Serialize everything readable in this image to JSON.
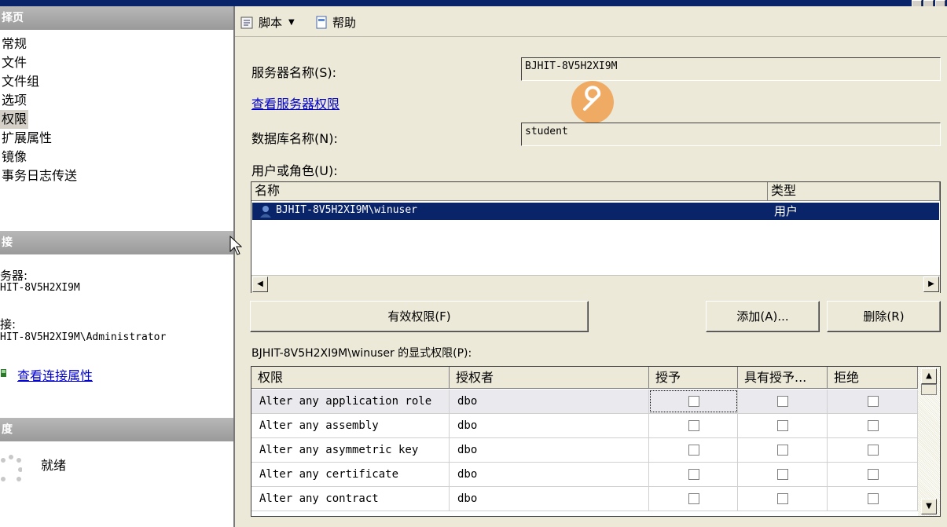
{
  "left": {
    "select_page_header": "择页",
    "nav": [
      "常规",
      "文件",
      "文件组",
      "选项",
      "权限",
      "扩展属性",
      "镜像",
      "事务日志传送"
    ],
    "selected_nav": 4,
    "connection_header": "接",
    "server_label": "务器:",
    "server_value": "HIT-8V5H2XI9M",
    "connection_label": "接:",
    "connection_value": "HIT-8V5H2XI9M\\Administrator",
    "view_conn_link": "查看连接属性",
    "progress_header": "度",
    "status": "就绪"
  },
  "toolbar": {
    "script_label": "脚本",
    "help_label": "帮助"
  },
  "form": {
    "server_name_label": "服务器名称(S):",
    "server_name_value": "BJHIT-8V5H2XI9M",
    "view_server_perms_link": "查看服务器权限",
    "db_name_label": "数据库名称(N):",
    "db_name_value": "student",
    "users_label": "用户或角色(U):"
  },
  "users": {
    "col_name": "名称",
    "col_type": "类型",
    "rows": [
      {
        "name": "BJHIT-8V5H2XI9M\\winuser",
        "type": "用户"
      }
    ]
  },
  "buttons": {
    "effective": "有效权限(F)",
    "add": "添加(A)...",
    "remove": "删除(R)"
  },
  "explicit_label": "BJHIT-8V5H2XI9M\\winuser 的显式权限(P):",
  "perms": {
    "headers": [
      "权限",
      "授权者",
      "授予",
      "具有授予...",
      "拒绝"
    ],
    "rows": [
      {
        "perm": "Alter any application role",
        "grantor": "dbo"
      },
      {
        "perm": "Alter any assembly",
        "grantor": "dbo"
      },
      {
        "perm": "Alter any asymmetric key",
        "grantor": "dbo"
      },
      {
        "perm": "Alter any certificate",
        "grantor": "dbo"
      },
      {
        "perm": "Alter any contract",
        "grantor": "dbo"
      }
    ]
  },
  "colors": {
    "selection": "#0a246a",
    "link": "#0000cc",
    "overlay_orange": "#f0a050"
  }
}
